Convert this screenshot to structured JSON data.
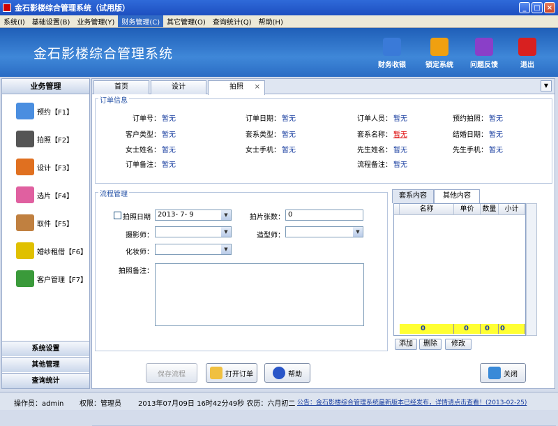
{
  "window": {
    "title": "金石影楼综合管理系统（试用版）"
  },
  "menu": [
    {
      "label": "系统(I)"
    },
    {
      "label": "基础设置(B)"
    },
    {
      "label": "业务管理(Y)"
    },
    {
      "label": "财务管理(C)",
      "active": true
    },
    {
      "label": "其它管理(O)"
    },
    {
      "label": "查询统计(Q)"
    },
    {
      "label": "帮助(H)"
    }
  ],
  "banner": {
    "title": "金石影楼综合管理系统",
    "buttons": [
      {
        "label": "财务收银",
        "icon": "cashier-icon",
        "color": "#3a7ad8"
      },
      {
        "label": "锁定系统",
        "icon": "lock-icon",
        "color": "#f0a010"
      },
      {
        "label": "问题反馈",
        "icon": "question-icon",
        "color": "#8a3fc8"
      },
      {
        "label": "退出",
        "icon": "power-icon",
        "color": "#d82020"
      }
    ]
  },
  "sidebar": {
    "header": "业务管理",
    "items": [
      {
        "label": "预约【F1】",
        "icon": "calendar-icon",
        "color": "#4a8ee0"
      },
      {
        "label": "拍照【F2】",
        "icon": "camera-icon",
        "color": "#555555"
      },
      {
        "label": "设计【F3】",
        "icon": "pencils-icon",
        "color": "#e07020"
      },
      {
        "label": "选片【F4】",
        "icon": "photo-icon",
        "color": "#e060a0"
      },
      {
        "label": "取件【F5】",
        "icon": "box-icon",
        "color": "#c08040"
      },
      {
        "label": "婚纱租借【F6】",
        "icon": "dress-icon",
        "color": "#e0c000"
      },
      {
        "label": "客户管理【F7】",
        "icon": "customer-icon",
        "color": "#3a9a3a"
      }
    ],
    "footers": [
      "系统设置",
      "其他管理",
      "查询统计"
    ]
  },
  "tabs": [
    {
      "label": "首页"
    },
    {
      "label": "设计"
    },
    {
      "label": "拍照",
      "active": true,
      "close": "×"
    }
  ],
  "dropdown_icon": "▼",
  "order_info": {
    "title": "订单信息",
    "fields": [
      {
        "label": "订单号：",
        "value": "暂无"
      },
      {
        "label": "订单日期：",
        "value": "暂无"
      },
      {
        "label": "订单人员：",
        "value": "暂无"
      },
      {
        "label": "预约拍照：",
        "value": "暂无"
      },
      {
        "label": "客户类型：",
        "value": "暂无"
      },
      {
        "label": "套系类型：",
        "value": "暂无"
      },
      {
        "label": "套系名称：",
        "value": "暂无",
        "red": true
      },
      {
        "label": "结婚日期：",
        "value": "暂无"
      },
      {
        "label": "女士姓名：",
        "value": "暂无"
      },
      {
        "label": "女士手机：",
        "value": "暂无"
      },
      {
        "label": "先生姓名：",
        "value": "暂无"
      },
      {
        "label": "先生手机：",
        "value": "暂无"
      },
      {
        "label": "订单备注：",
        "value": "暂无"
      },
      {
        "label": "流程备注：",
        "value": "暂无"
      }
    ]
  },
  "process": {
    "title": "流程管理",
    "photo_date_label": "拍照日期",
    "photo_date_value": "2013- 7- 9",
    "photo_count_label": "拍片张数：",
    "photo_count_value": "0",
    "photographer_label": "摄影师：",
    "stylist_label": "造型师：",
    "makeup_label": "化妆师：",
    "notes_label": "拍照备注："
  },
  "content_tabs": [
    {
      "label": "套系内容"
    },
    {
      "label": "其他内容",
      "active": true
    }
  ],
  "grid": {
    "columns": [
      "名称",
      "单价",
      "数量",
      "小计"
    ],
    "totals": [
      "0",
      "0",
      "0",
      "0"
    ]
  },
  "grid_buttons": [
    "添加",
    "删除",
    "修改"
  ],
  "actions": {
    "save": "保存流程",
    "open": "打开订单",
    "help": "帮助",
    "close": "关闭"
  },
  "status": {
    "operator": "操作员：admin",
    "permission": "权限：管理员",
    "datetime": "2013年07月09日  16时42分49秒  农历：六月初二",
    "notice": "公告：金石影楼综合管理系统最新版本已经发布，详情请点击查看！(2013-02-25)"
  }
}
